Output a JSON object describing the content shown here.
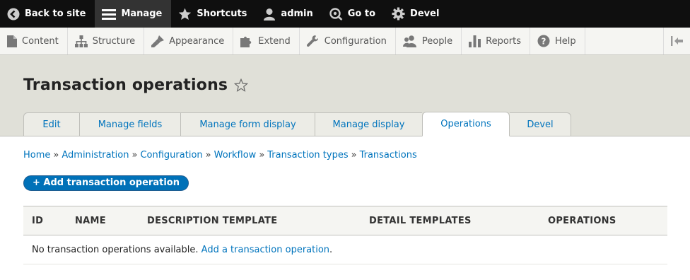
{
  "toolbar": {
    "items": [
      {
        "label": "Back to site",
        "icon": "back-arrow-circle-icon"
      },
      {
        "label": "Manage",
        "icon": "hamburger-menu-icon"
      },
      {
        "label": "Shortcuts",
        "icon": "star-icon"
      },
      {
        "label": "admin",
        "icon": "user-icon"
      },
      {
        "label": "Go to",
        "icon": "goto-icon"
      },
      {
        "label": "Devel",
        "icon": "gear-icon"
      }
    ]
  },
  "tray": {
    "items": [
      {
        "label": "Content",
        "icon": "file-icon"
      },
      {
        "label": "Structure",
        "icon": "sitemap-icon"
      },
      {
        "label": "Appearance",
        "icon": "paintbrush-icon"
      },
      {
        "label": "Extend",
        "icon": "puzzle-icon"
      },
      {
        "label": "Configuration",
        "icon": "wrench-icon"
      },
      {
        "label": "People",
        "icon": "people-icon"
      },
      {
        "label": "Reports",
        "icon": "bar-chart-icon"
      },
      {
        "label": "Help",
        "icon": "help-circle-icon"
      }
    ]
  },
  "page": {
    "title": "Transaction operations"
  },
  "tabs": [
    {
      "label": "Edit",
      "active": false
    },
    {
      "label": "Manage fields",
      "active": false
    },
    {
      "label": "Manage form display",
      "active": false
    },
    {
      "label": "Manage display",
      "active": false
    },
    {
      "label": "Operations",
      "active": true
    },
    {
      "label": "Devel",
      "active": false
    }
  ],
  "breadcrumb": [
    "Home",
    "Administration",
    "Configuration",
    "Workflow",
    "Transaction types",
    "Transactions"
  ],
  "breadcrumb_separator": "»",
  "action": {
    "label": "+ Add transaction operation"
  },
  "table": {
    "columns": [
      "ID",
      "NAME",
      "DESCRIPTION TEMPLATE",
      "DETAIL TEMPLATES",
      "OPERATIONS"
    ],
    "empty_text": "No transaction operations available.",
    "empty_link": "Add a transaction operation",
    "empty_suffix": "."
  },
  "colors": {
    "link": "#0074bd",
    "toolbar_bg": "#0f0f0f",
    "button_bg": "#0071b8",
    "header_bg": "#e0e0d8"
  }
}
